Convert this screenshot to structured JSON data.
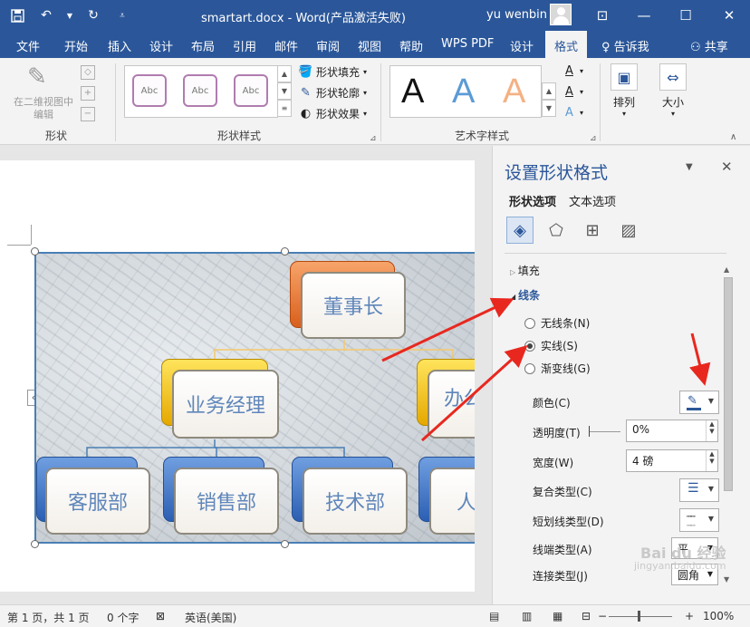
{
  "titlebar": {
    "doc_title": "smartart.docx  -  Word(产品激活失败)",
    "user": "yu wenbin"
  },
  "tabs": [
    {
      "label": "文件"
    },
    {
      "label": "开始"
    },
    {
      "label": "插入"
    },
    {
      "label": "设计"
    },
    {
      "label": "布局"
    },
    {
      "label": "引用"
    },
    {
      "label": "邮件"
    },
    {
      "label": "审阅"
    },
    {
      "label": "视图"
    },
    {
      "label": "帮助"
    },
    {
      "label": "WPS PDF"
    },
    {
      "label": "设计"
    },
    {
      "label": "格式"
    }
  ],
  "tell_me": "告诉我",
  "share": "共享",
  "ribbon": {
    "shape_group": {
      "edit_in_2d": "在二维视图中编辑",
      "label": "形状"
    },
    "shape_styles": {
      "items": [
        "Abc",
        "Abc",
        "Abc"
      ],
      "fill": "形状填充",
      "outline": "形状轮廓",
      "effects": "形状效果",
      "label": "形状样式"
    },
    "wordart": {
      "label": "艺术字样式",
      "sample": "A"
    },
    "arrange": "排列",
    "size": "大小"
  },
  "smartart": {
    "top": "董事长",
    "mid_left": "业务经理",
    "mid_right": "办公",
    "bottom": [
      "客服部",
      "销售部",
      "技术部",
      "人"
    ]
  },
  "pane": {
    "title": "设置形状格式",
    "tabs": [
      "形状选项",
      "文本选项"
    ],
    "fill": "填充",
    "line": "线条",
    "radio": {
      "none": "无线条(N)",
      "solid": "实线(S)",
      "gradient": "渐变线(G)"
    },
    "selected_line": "solid",
    "props": {
      "color": "颜色(C)",
      "transparency": "透明度(T)",
      "transparency_value": "0%",
      "width": "宽度(W)",
      "width_value": "4 磅",
      "compound": "复合类型(C)",
      "dash": "短划线类型(D)",
      "cap": "线端类型(A)",
      "cap_value": "平",
      "join": "连接类型(J)",
      "join_value": "圆角"
    }
  },
  "status": {
    "page": "第 1 页，共 1 页",
    "words": "0 个字",
    "lang": "英语(美国)",
    "zoom": "100%"
  },
  "watermark": {
    "line1": "Bai du 经验",
    "line2": "jingyan.baidu.com"
  },
  "colors": {
    "word_blue": "#2b579a",
    "annotation_red": "#e8281f"
  }
}
